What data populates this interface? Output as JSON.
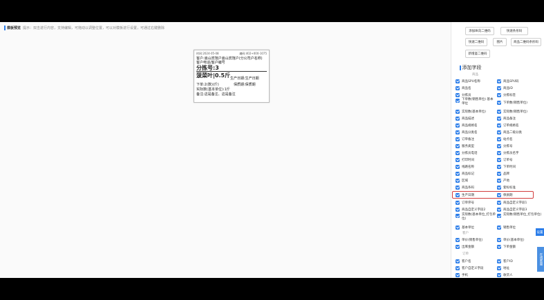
{
  "preview": {
    "title": "模板预览",
    "hint": "提示：双击进行内容，支持编辑，可拖动以调整位置，可以对模板进行设置，可通过右键删除"
  },
  "label": {
    "date": "时间:2024-05-08",
    "code": "编码:402+000-1075",
    "customer": "客户:嵩山宾馆户嵩山宾馆户(分公司户名称)",
    "phone": "客户电话/客户编号",
    "sort": "分拣号:3",
    "product": "菠菜叶|0.5斤",
    "prodate": "生产日期:生产日期",
    "qty": "下单:2(数)(斤)",
    "shelf": "保质期:保质期",
    "actual": "实际数(基本单位):1斤",
    "note": "备注:这是备注、这是备注"
  },
  "panel": {
    "buttons": [
      "添加纵向二维码",
      "快速条形码",
      "快速二维码",
      "图片",
      "商品二维码条形码",
      "新增竖二维码"
    ],
    "section_title": "添加字段",
    "groups": {
      "goods": "商品",
      "customer": "客户",
      "order": "订单"
    },
    "fields": [
      "商品SPU名称",
      "商品SPU码",
      "商品名",
      "商品ID",
      "分拣员",
      "分拣标签",
      "下单数(销售单位) 基本单位",
      "下单数(销售单位)",
      "实际数(基本单位)",
      "实际数(销售单位)",
      "商品描述",
      "商品备注",
      "商品规格名",
      "订单规格名",
      "商品分类名",
      "商品二级分类",
      "订单备注",
      "站点名",
      "服务类型",
      "分拣号",
      "分拣员电话",
      "分拣员名字",
      "打印时间",
      "订单号",
      "线路名称",
      "下单时间",
      "商品标记",
      "品牌",
      "区域",
      "产地",
      "商品条码",
      "套标标准",
      "生产日期",
      "保质期",
      "订单序号",
      "商品自定义字段1",
      "商品自定义字段2",
      "商品自定义字段3",
      "实际数(基本单位_打包单位)",
      "实际数(销售单位_打包单位)",
      "基本单位",
      "销售单位"
    ],
    "customer_fields": [
      "单价(销售单位)",
      "单价(基本单位)",
      "出库金额",
      "下单金额"
    ],
    "order_fields": [
      "客户名",
      "客户ID",
      "客户自定义字段",
      "地址",
      "手机",
      "收货人"
    ],
    "side_tab": "设置",
    "side_tab2": "在线客服"
  }
}
